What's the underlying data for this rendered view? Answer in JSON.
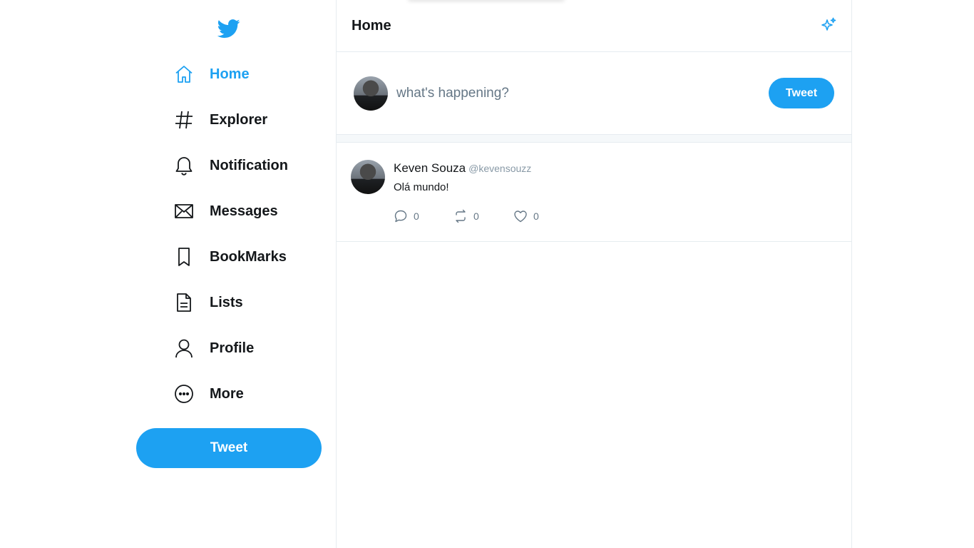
{
  "nav": {
    "items": [
      {
        "label": "Home",
        "icon": "home-icon"
      },
      {
        "label": "Explorer",
        "icon": "hashtag-icon"
      },
      {
        "label": "Notification",
        "icon": "bell-icon"
      },
      {
        "label": "Messages",
        "icon": "envelope-icon"
      },
      {
        "label": "BookMarks",
        "icon": "bookmark-icon"
      },
      {
        "label": "Lists",
        "icon": "list-icon"
      },
      {
        "label": "Profile",
        "icon": "user-icon"
      },
      {
        "label": "More",
        "icon": "more-icon"
      }
    ],
    "tweet_label": "Tweet"
  },
  "header": {
    "title": "Home"
  },
  "composer": {
    "placeholder": "what's happening?",
    "tweet_label": "Tweet"
  },
  "post": {
    "name": "Keven Souza",
    "handle": "@kevensouzz",
    "text": "Olá mundo!",
    "replies": "0",
    "retweets": "0",
    "likes": "0"
  },
  "colors": {
    "accent": "#1da1f2",
    "text": "#14171a",
    "muted": "#657786"
  }
}
